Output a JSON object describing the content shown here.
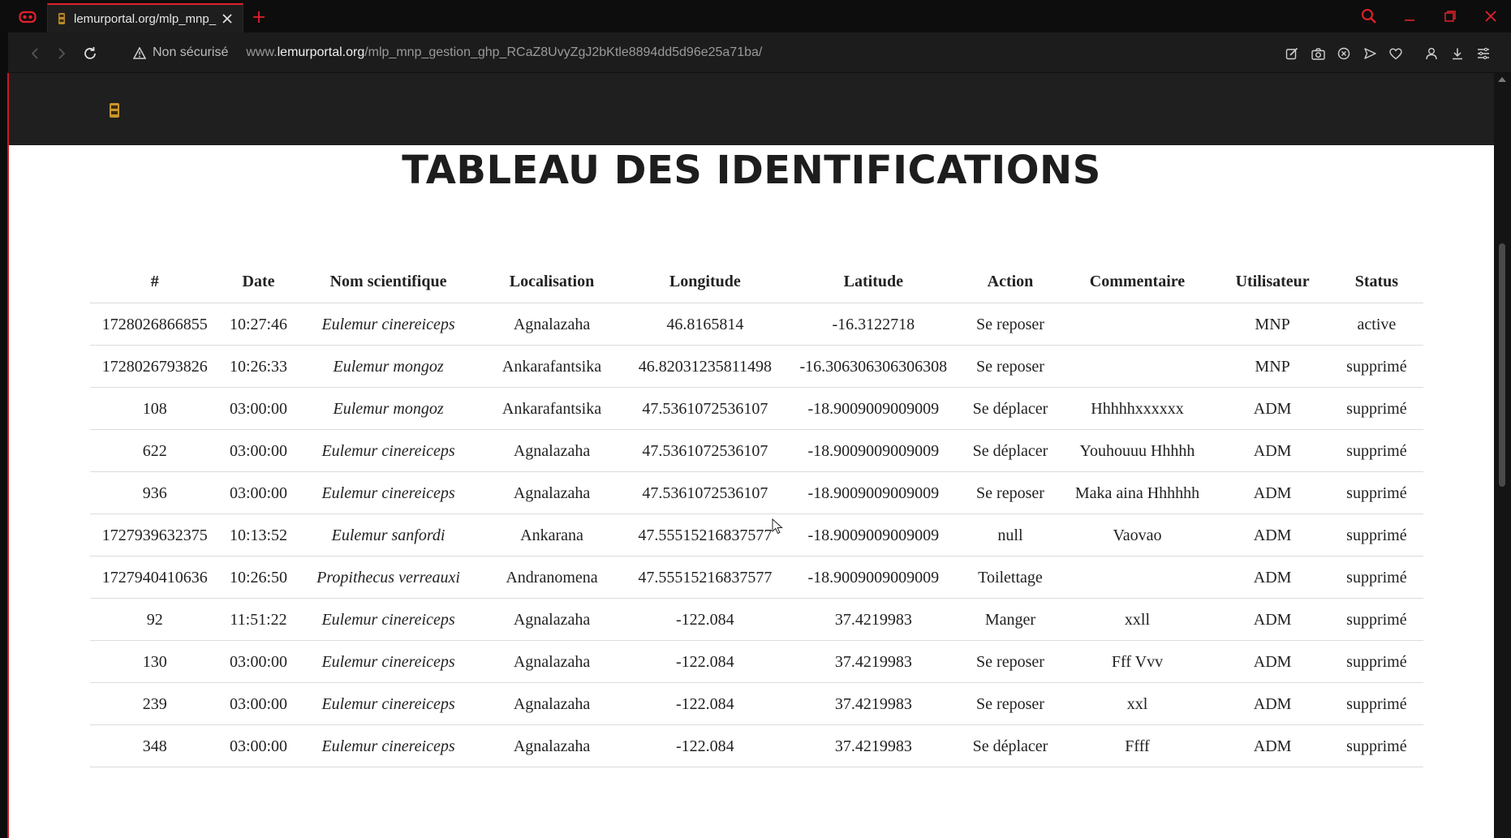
{
  "browser": {
    "tab_title": "lemurportal.org/mlp_mnp_",
    "not_secure_label": "Non sécurisé",
    "url_domain_prefix": "www.",
    "url_domain": "lemurportal.org",
    "url_path": "/mlp_mnp_gestion_ghp_RCaZ8UvyZgJ2bKtle8894dd5d96e25a71ba/",
    "icons": [
      "browser-logo-icon",
      "back-icon",
      "forward-icon",
      "reload-icon",
      "warning-icon",
      "edit-icon",
      "camera-icon",
      "block-icon",
      "send-icon",
      "heart-icon",
      "user-icon",
      "download-icon",
      "menu-icon",
      "search-icon",
      "minimize-icon",
      "maximize-icon",
      "close-icon"
    ],
    "accent_color": "#e2212d"
  },
  "page": {
    "title": "TABLEAU DES IDENTIFICATIONS"
  },
  "table": {
    "headers": [
      "#",
      "Date",
      "Nom scientifique",
      "Localisation",
      "Longitude",
      "Latitude",
      "Action",
      "Commentaire",
      "Utilisateur",
      "Status"
    ],
    "rows": [
      [
        "1728026866855",
        "10:27:46",
        "Eulemur cinereiceps",
        "Agnalazaha",
        "46.8165814",
        "-16.3122718",
        "Se reposer",
        "",
        "MNP",
        "active"
      ],
      [
        "1728026793826",
        "10:26:33",
        "Eulemur mongoz",
        "Ankarafantsika",
        "46.82031235811498",
        "-16.306306306306308",
        "Se reposer",
        "",
        "MNP",
        "supprimé"
      ],
      [
        "108",
        "03:00:00",
        "Eulemur mongoz",
        "Ankarafantsika",
        "47.5361072536107",
        "-18.9009009009009",
        "Se déplacer",
        "Hhhhhxxxxxx",
        "ADM",
        "supprimé"
      ],
      [
        "622",
        "03:00:00",
        "Eulemur cinereiceps",
        "Agnalazaha",
        "47.5361072536107",
        "-18.9009009009009",
        "Se déplacer",
        "Youhouuu Hhhhh",
        "ADM",
        "supprimé"
      ],
      [
        "936",
        "03:00:00",
        "Eulemur cinereiceps",
        "Agnalazaha",
        "47.5361072536107",
        "-18.9009009009009",
        "Se reposer",
        "Maka aina Hhhhhh",
        "ADM",
        "supprimé"
      ],
      [
        "1727939632375",
        "10:13:52",
        "Eulemur sanfordi",
        "Ankarana",
        "47.55515216837577",
        "-18.9009009009009",
        "null",
        "Vaovao",
        "ADM",
        "supprimé"
      ],
      [
        "1727940410636",
        "10:26:50",
        "Propithecus verreauxi",
        "Andranomena",
        "47.55515216837577",
        "-18.9009009009009",
        "Toilettage",
        "",
        "ADM",
        "supprimé"
      ],
      [
        "92",
        "11:51:22",
        "Eulemur cinereiceps",
        "Agnalazaha",
        "-122.084",
        "37.4219983",
        "Manger",
        "xxll",
        "ADM",
        "supprimé"
      ],
      [
        "130",
        "03:00:00",
        "Eulemur cinereiceps",
        "Agnalazaha",
        "-122.084",
        "37.4219983",
        "Se reposer",
        "Fff Vvv",
        "ADM",
        "supprimé"
      ],
      [
        "239",
        "03:00:00",
        "Eulemur cinereiceps",
        "Agnalazaha",
        "-122.084",
        "37.4219983",
        "Se reposer",
        "xxl",
        "ADM",
        "supprimé"
      ],
      [
        "348",
        "03:00:00",
        "Eulemur cinereiceps",
        "Agnalazaha",
        "-122.084",
        "37.4219983",
        "Se déplacer",
        "Ffff",
        "ADM",
        "supprimé"
      ]
    ]
  }
}
